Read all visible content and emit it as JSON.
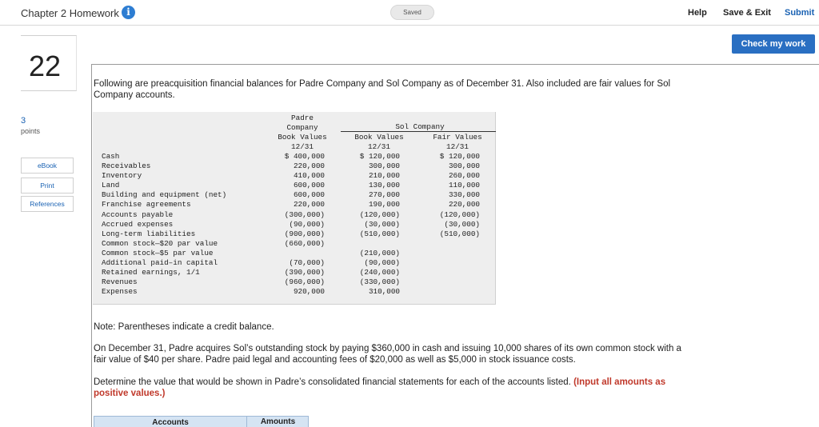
{
  "header": {
    "title": "Chapter 2 Homework",
    "info_icon": "info-icon",
    "saved_label": "Saved",
    "help_label": "Help",
    "save_exit_label": "Save & Exit",
    "submit_label": "Submit"
  },
  "check_my_work_label": "Check my work",
  "question": {
    "number": "22",
    "points_value": "3",
    "points_label": "points",
    "buttons": {
      "ebook": "eBook",
      "print": "Print",
      "references": "References"
    }
  },
  "content": {
    "intro": "Following are preacquisition financial balances for Padre Company and Sol Company as of December 31. Also included are fair values for Sol Company accounts.",
    "note": "Note: Parentheses indicate a credit balance.",
    "scenario": "On December 31, Padre acquires Sol’s outstanding stock by paying $360,000 in cash and issuing 10,000 shares of its own common stock with a fair value of $40 per share. Padre paid legal and accounting fees of $20,000 as well as $5,000 in stock issuance costs.",
    "determine": "Determine the value that would be shown in Padre’s consolidated financial statements for each of the accounts listed.",
    "determine_emphasis": "(Input all amounts as positive values.)"
  },
  "fin_table": {
    "padre_header_1": "Padre",
    "padre_header_2": "Company",
    "padre_header_3": "Book Values",
    "sol_header": "Sol Company",
    "sol_book_header": "Book Values",
    "sol_fair_header": "Fair Values",
    "date_label": "12/31",
    "rows": [
      {
        "account": "Cash",
        "padre": "$ 400,000",
        "sol_book": "$ 120,000",
        "sol_fair": "$ 120,000"
      },
      {
        "account": "Receivables",
        "padre": "220,000",
        "sol_book": "300,000",
        "sol_fair": "300,000"
      },
      {
        "account": "Inventory",
        "padre": "410,000",
        "sol_book": "210,000",
        "sol_fair": "260,000"
      },
      {
        "account": "Land",
        "padre": "600,000",
        "sol_book": "130,000",
        "sol_fair": "110,000"
      },
      {
        "account": "Building and equipment (net)",
        "padre": "600,000",
        "sol_book": "270,000",
        "sol_fair": "330,000"
      },
      {
        "account": "Franchise agreements",
        "padre": "220,000",
        "sol_book": "190,000",
        "sol_fair": "220,000"
      },
      {
        "account": "Accounts payable",
        "padre": "(300,000)",
        "sol_book": "(120,000)",
        "sol_fair": "(120,000)"
      },
      {
        "account": "Accrued expenses",
        "padre": "(90,000)",
        "sol_book": "(30,000)",
        "sol_fair": "(30,000)"
      },
      {
        "account": "Long-term liabilities",
        "padre": "(900,000)",
        "sol_book": "(510,000)",
        "sol_fair": "(510,000)"
      },
      {
        "account": "Common stock—$20 par value",
        "padre": "(660,000)",
        "sol_book": "",
        "sol_fair": ""
      },
      {
        "account": "Common stock—$5 par value",
        "padre": "",
        "sol_book": "(210,000)",
        "sol_fair": ""
      },
      {
        "account": "Additional paid–in capital",
        "padre": "(70,000)",
        "sol_book": "(90,000)",
        "sol_fair": ""
      },
      {
        "account": "Retained earnings, 1/1",
        "padre": "(390,000)",
        "sol_book": "(240,000)",
        "sol_fair": ""
      },
      {
        "account": "Revenues",
        "padre": "(960,000)",
        "sol_book": "(330,000)",
        "sol_fair": ""
      },
      {
        "account": "Expenses",
        "padre": "920,000",
        "sol_book": "310,000",
        "sol_fair": ""
      }
    ]
  },
  "answer_table": {
    "accounts_header": "Accounts",
    "amounts_header": "Amounts"
  }
}
